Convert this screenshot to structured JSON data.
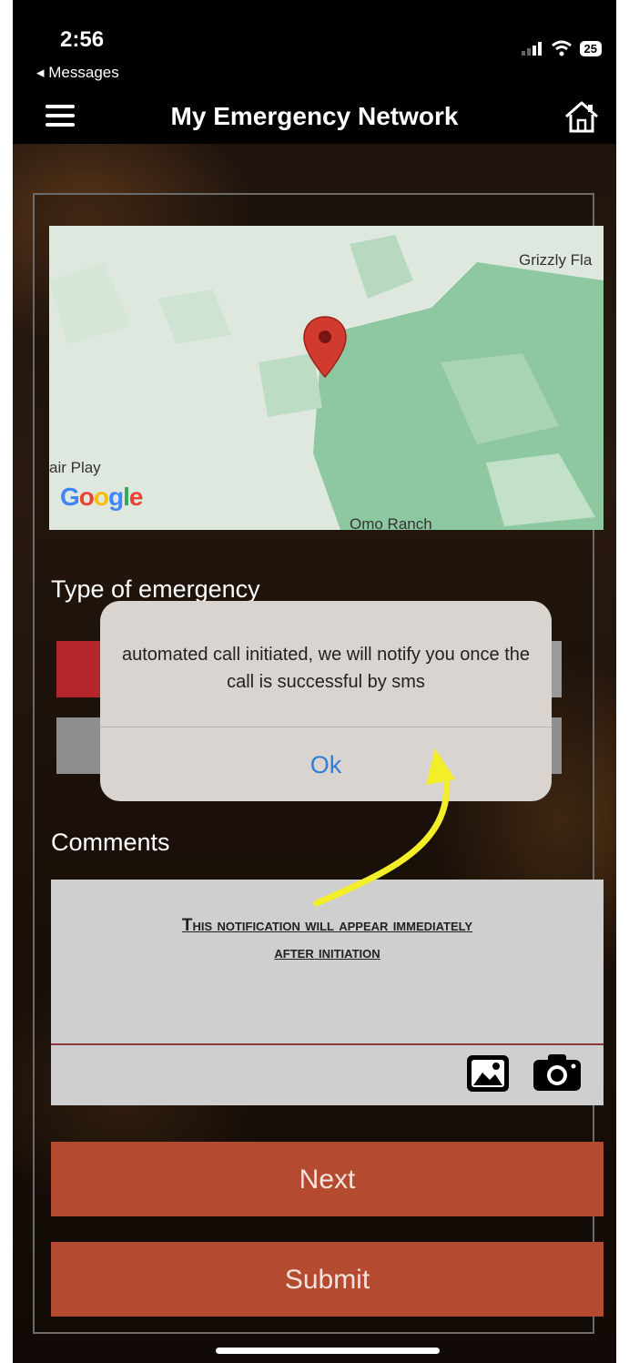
{
  "status_bar": {
    "time": "2:56",
    "back_label": "◂ Messages",
    "battery": "25"
  },
  "nav": {
    "title": "My Emergency Network",
    "menu_icon": "hamburger-menu-icon",
    "home_icon": "home-icon"
  },
  "map": {
    "labels": [
      "Grizzly Fla",
      "air Play",
      "Omo Ranch"
    ],
    "logo_text": "Google",
    "marker_icon": "map-pin-icon",
    "colors": {
      "land": "#dfe8df",
      "forest": "#8ec8a0",
      "marker": "#d03a2f"
    }
  },
  "emergency": {
    "label": "Type of emergency",
    "option_colors": [
      "#b3262c",
      "#9a9a9a"
    ]
  },
  "dialog": {
    "message": "automated call initiated, we will notify you once the call is successful by sms",
    "ok_label": "Ok"
  },
  "comments": {
    "label": "Comments",
    "annotation_line1": "This notification will appear immediately",
    "annotation_line2": "after initiation",
    "image_icon": "image-icon",
    "camera_icon": "camera-icon"
  },
  "buttons": {
    "next": "Next",
    "submit": "Submit"
  },
  "colors": {
    "accent": "#b44a30",
    "dialog_link": "#2f7fd8",
    "annotation_arrow": "#f2ee2a"
  }
}
